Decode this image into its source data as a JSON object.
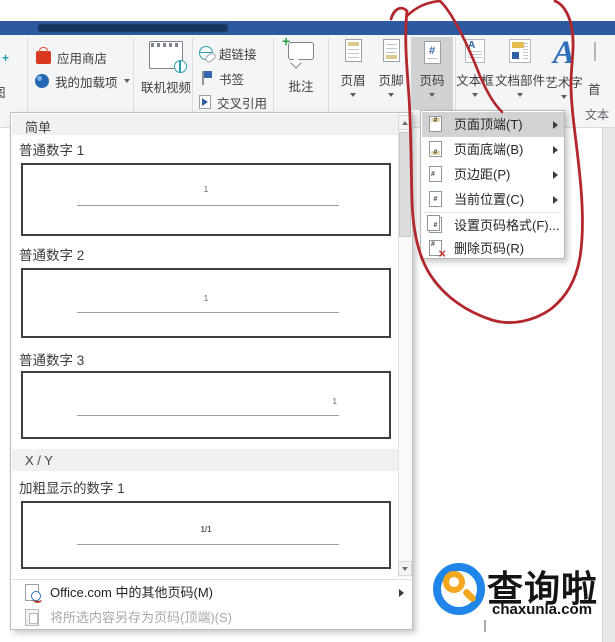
{
  "ribbon": {
    "partial_screenshot_label": "图",
    "app_store": "应用商店",
    "my_addins": "我的加载项",
    "online_video": "联机视频",
    "hyperlink": "超链接",
    "bookmark": "书签",
    "cross_reference": "交叉引用",
    "comment": "批注",
    "header": "页眉",
    "footer": "页脚",
    "page_number": "页码",
    "text_box": "文本框",
    "quick_parts": "文档部件",
    "wordart": "艺术字",
    "partial_right_label": "首",
    "text_group_label": "文本"
  },
  "menu": {
    "items": [
      {
        "label": "页面顶端(T)",
        "highlighted": true,
        "has_submenu": true
      },
      {
        "label": "页面底端(B)",
        "highlighted": false,
        "has_submenu": true
      },
      {
        "label": "页边距(P)",
        "highlighted": false,
        "has_submenu": true
      },
      {
        "label": "当前位置(C)",
        "highlighted": false,
        "has_submenu": true
      },
      {
        "label": "设置页码格式(F)...",
        "highlighted": false,
        "has_submenu": false
      },
      {
        "label": "删除页码(R)",
        "highlighted": false,
        "has_submenu": false
      }
    ]
  },
  "gallery": {
    "section_simple": "简单",
    "item1_label": "普通数字 1",
    "item2_label": "普通数字 2",
    "item3_label": "普通数字 3",
    "section_xy": "X / Y",
    "item4_label": "加粗显示的数字 1",
    "preview_number": "1",
    "preview_fraction": "1/1",
    "footer_more": "Office.com 中的其他页码(M)",
    "footer_save": "将所选内容另存为页码(顶端)(S)"
  },
  "watermark": {
    "brand": "查询啦",
    "domain": "chaxunla.com"
  },
  "glyphs": {
    "hash": "#",
    "plus": "+",
    "letter_a": "A",
    "x_mark": "×"
  },
  "icons": {
    "scroll_up": "triangle-up",
    "scroll_down": "triangle-down",
    "submenu_arrow": "triangle-right",
    "dropdown_caret": "triangle-down",
    "app_store": "orange-bag",
    "my_addins": "blue-circle",
    "online_video": "film-globe",
    "hyperlink": "globe-chain",
    "bookmark": "blue-flag",
    "cross_reference": "page-arrow",
    "comment": "bubble-plus",
    "page_number_menu": "page-hash",
    "delete_page_number": "page-red-x",
    "office_more": "page-globe",
    "save_selection": "gray-pages"
  },
  "colors": {
    "titlebar": "#2d5a9e",
    "annotation": "#b3262c",
    "menu_highlight": "#d2d2d2",
    "pressed_button": "#d0d1d3",
    "accent_blue": "#2f6db8",
    "brand_blue": "#1f85e8",
    "brand_orange": "#f2a71f"
  }
}
